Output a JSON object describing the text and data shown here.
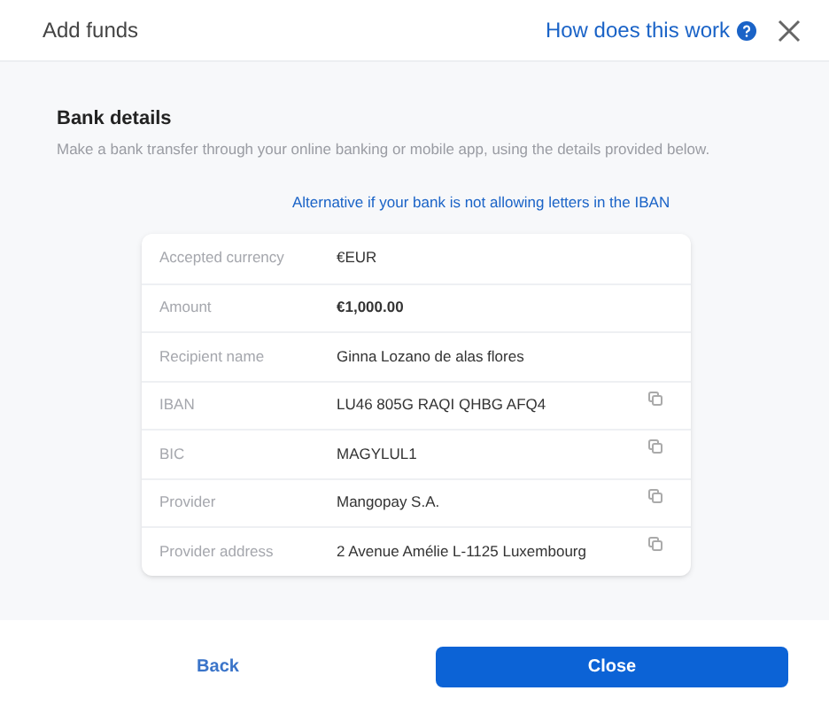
{
  "header": {
    "title": "Add funds",
    "help_link": "How does this work"
  },
  "section": {
    "title": "Bank details",
    "description": "Make a bank transfer through your online banking or mobile app, using the details provided below.",
    "alt_link": "Alternative if your bank is not allowing letters in the IBAN"
  },
  "details": [
    {
      "label": "Accepted currency",
      "value": "€EUR",
      "bold": false,
      "copyable": false
    },
    {
      "label": "Amount",
      "value": "€1,000.00",
      "bold": true,
      "copyable": false
    },
    {
      "label": "Recipient name",
      "value": "Ginna Lozano de alas flores",
      "bold": false,
      "copyable": false
    },
    {
      "label": "IBAN",
      "value": "LU46 805G RAQI QHBG AFQ4",
      "bold": false,
      "copyable": true
    },
    {
      "label": "BIC",
      "value": "MAGYLUL1",
      "bold": false,
      "copyable": true
    },
    {
      "label": "Provider",
      "value": "Mangopay S.A.",
      "bold": false,
      "copyable": true
    },
    {
      "label": "Provider address",
      "value": "2 Avenue Amélie L-1125 Luxembourg",
      "bold": false,
      "copyable": true
    }
  ],
  "footer": {
    "back": "Back",
    "close": "Close"
  }
}
